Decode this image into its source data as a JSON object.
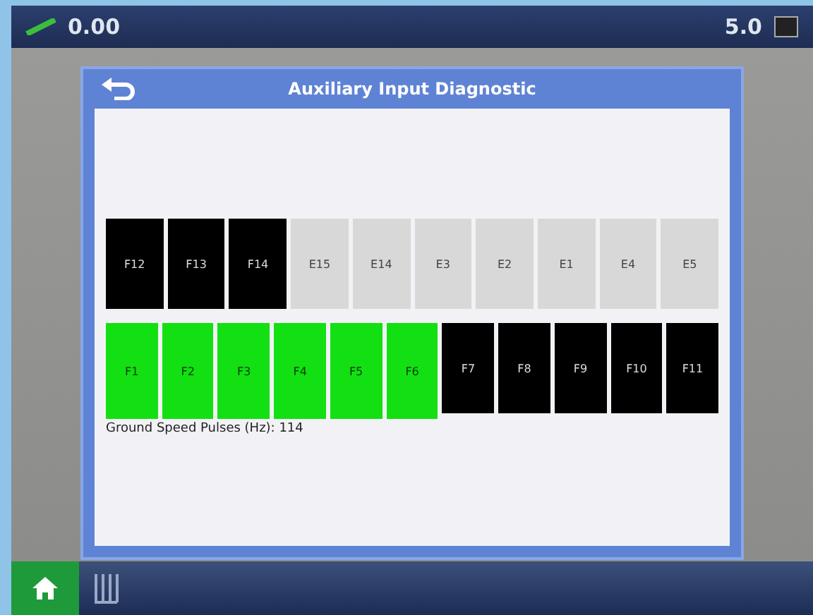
{
  "top_bar": {
    "left_reading": "0.00",
    "right_reading": "5.0"
  },
  "dialog": {
    "title": "Auxiliary Input Diagnostic",
    "upper_indicators": [
      {
        "label": "F12",
        "on": false,
        "disabled": false
      },
      {
        "label": "F13",
        "on": false,
        "disabled": false
      },
      {
        "label": "F14",
        "on": false,
        "disabled": false
      },
      {
        "label": "E15",
        "disabled": true
      },
      {
        "label": "E14",
        "disabled": true
      },
      {
        "label": "E3",
        "disabled": true
      },
      {
        "label": "E2",
        "disabled": true
      },
      {
        "label": "E1",
        "disabled": true
      },
      {
        "label": "E4",
        "disabled": true
      },
      {
        "label": "E5",
        "disabled": true
      }
    ],
    "lower_indicators": [
      {
        "label": "F1",
        "on": true,
        "disabled": false
      },
      {
        "label": "F2",
        "on": true,
        "disabled": false
      },
      {
        "label": "F3",
        "on": true,
        "disabled": false
      },
      {
        "label": "F4",
        "on": true,
        "disabled": false
      },
      {
        "label": "F5",
        "on": true,
        "disabled": false
      },
      {
        "label": "F6",
        "on": true,
        "disabled": false
      },
      {
        "label": "F7",
        "on": false,
        "disabled": false
      },
      {
        "label": "F8",
        "on": false,
        "disabled": false
      },
      {
        "label": "F9",
        "on": false,
        "disabled": false
      },
      {
        "label": "F10",
        "on": false,
        "disabled": false
      },
      {
        "label": "F11",
        "on": false,
        "disabled": false
      }
    ],
    "reading": "Ground Speed Pulses (Hz): 114"
  }
}
